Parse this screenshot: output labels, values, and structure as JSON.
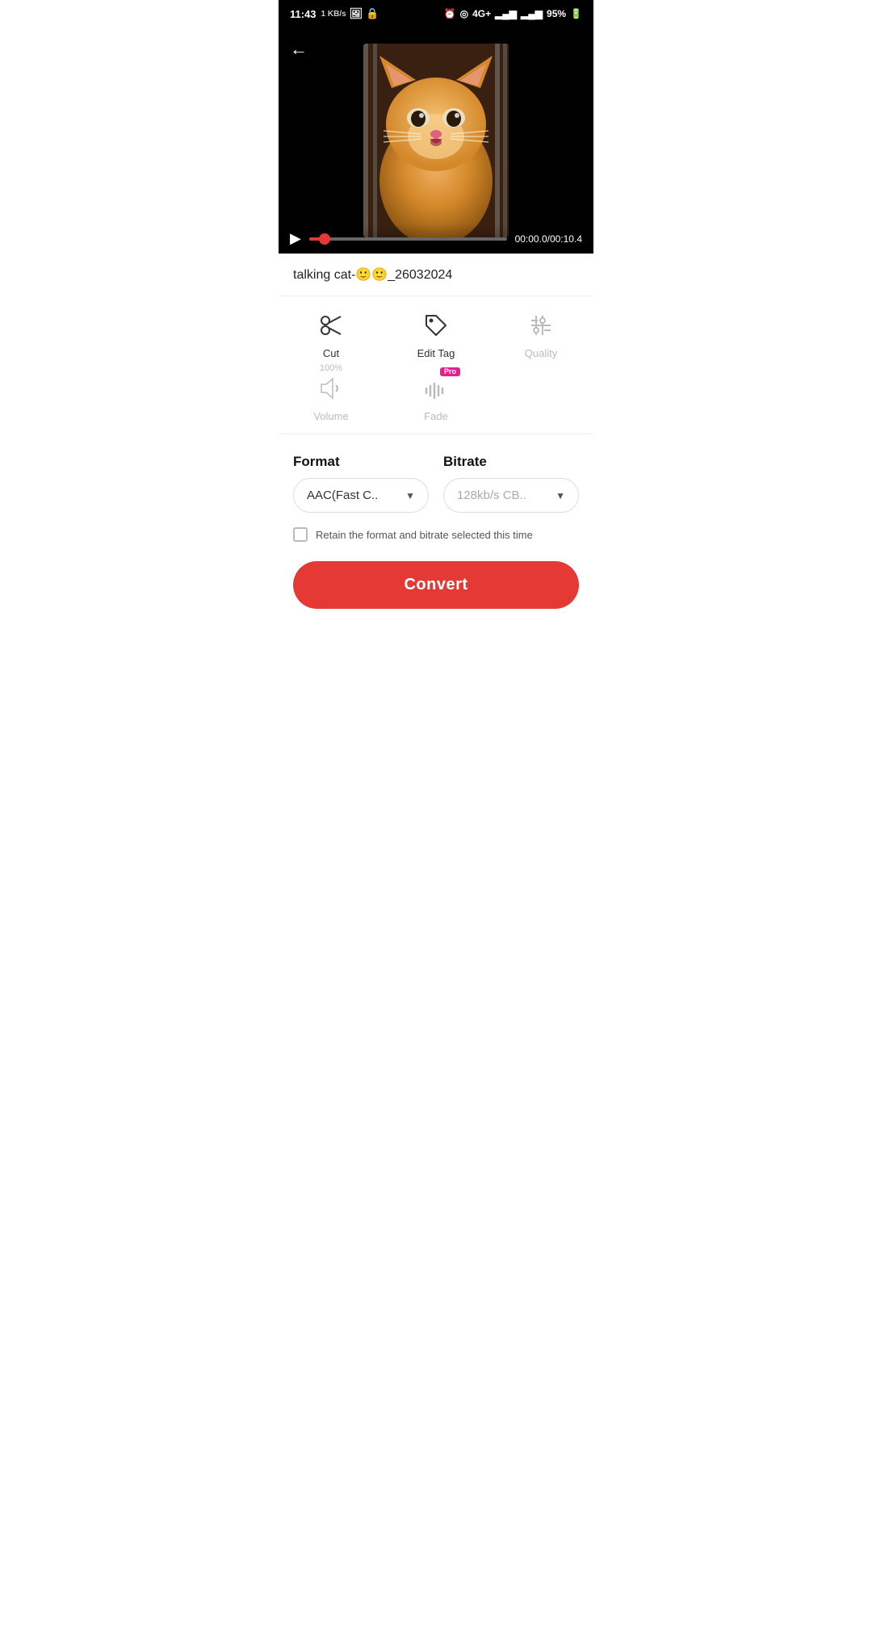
{
  "statusBar": {
    "time": "11:43",
    "network_speed": "1 KB/s",
    "battery": "95%",
    "signal": "4G+"
  },
  "video": {
    "back_label": "←",
    "time_current": "00:00.0",
    "time_total": "00:10.4",
    "time_display": "00:00.0/00:10.4",
    "progress_percent": 8
  },
  "filename": "talking cat-🙂🙂_26032024",
  "actions": {
    "cut_label": "Cut",
    "edit_tag_label": "Edit Tag",
    "quality_label": "Quality",
    "volume_label": "Volume",
    "volume_percent": "100%",
    "fade_label": "Fade"
  },
  "format_section": {
    "format_label": "Format",
    "format_value": "AAC(Fast C..",
    "bitrate_label": "Bitrate",
    "bitrate_value": "128kb/s CB..",
    "retain_label": "Retain the format and bitrate selected this time"
  },
  "convert_button": "Convert"
}
